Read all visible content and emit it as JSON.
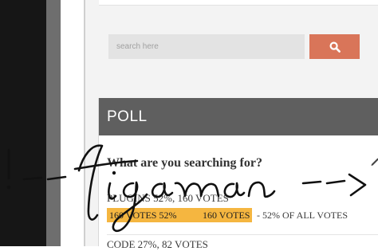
{
  "search": {
    "placeholder": "search here",
    "button_icon": "search-icon"
  },
  "poll": {
    "title": "POLL",
    "question": "What are you searching for?",
    "answers": [
      {
        "label": "PLUGINS 52%, 160 VOTES",
        "bar_text_left": "160 VOTES 52%",
        "bar_text_right": "160 VOTES",
        "tail_text": "- 52% OF ALL VOTES",
        "percent": 52
      },
      {
        "label": "CODE 27%, 82 VOTES"
      }
    ]
  },
  "overlay": {
    "text": "!-- tigaman -->"
  },
  "colors": {
    "accent": "#d97559",
    "bar": "#f5b640",
    "header": "#5f5f5f"
  }
}
